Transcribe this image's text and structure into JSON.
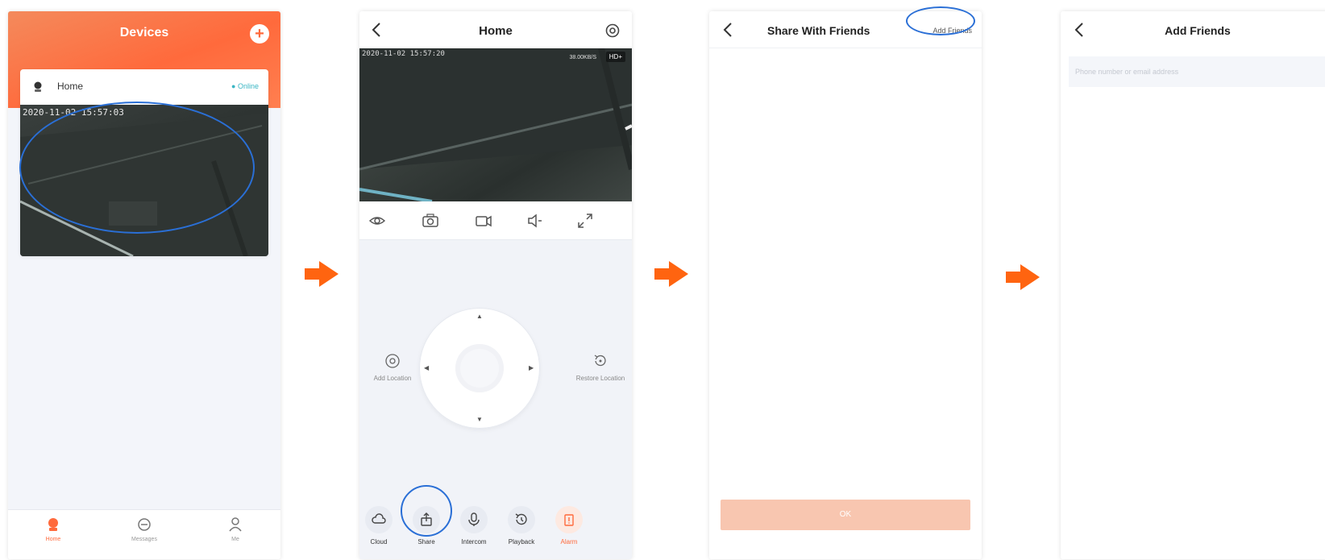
{
  "screen1": {
    "title": "Devices",
    "add_label": "+",
    "device": {
      "name": "Home",
      "status": "● Online",
      "timestamp": "2020-11-02 15:57:03"
    },
    "tabs": [
      {
        "label": "Home",
        "icon": "home-icon",
        "active": true
      },
      {
        "label": "Messages",
        "icon": "messages-icon",
        "active": false
      },
      {
        "label": "Me",
        "icon": "profile-icon",
        "active": false
      }
    ]
  },
  "screen2": {
    "title": "Home",
    "video": {
      "timestamp": "2020-11-02 15:57:20",
      "rate": "38.00KB/S",
      "quality": "HD+"
    },
    "toolbar": [
      "eye-icon",
      "camera-icon",
      "record-icon",
      "speaker-icon",
      "fullscreen-icon"
    ],
    "add_location": "Add Location",
    "restore_location": "Restore Location",
    "bottom": [
      {
        "label": "Cloud",
        "icon": "cloud-icon"
      },
      {
        "label": "Share",
        "icon": "share-icon"
      },
      {
        "label": "Intercom",
        "icon": "microphone-icon"
      },
      {
        "label": "Playback",
        "icon": "playback-icon"
      },
      {
        "label": "Alarm",
        "icon": "alarm-icon"
      }
    ]
  },
  "screen3": {
    "title": "Share With Friends",
    "add_friends": "Add Friends",
    "ok_label": "OK"
  },
  "screen4": {
    "title": "Add Friends",
    "input_placeholder": "Phone number or email address"
  },
  "colors": {
    "accent": "#ff6a3c",
    "highlight": "#2a6fd6",
    "online": "#3bb6c4",
    "ok_disabled": "#f8c6b0"
  }
}
